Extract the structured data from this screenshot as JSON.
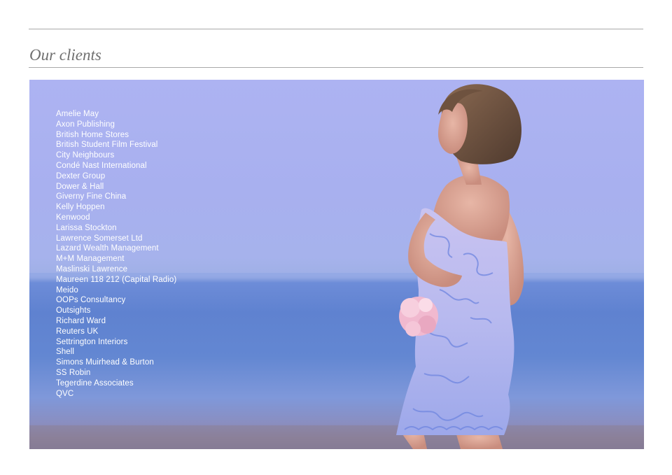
{
  "heading": "Our clients",
  "photo_icon": "model-on-beach-photo",
  "clients": [
    "Amelie May",
    "Axon Publishing",
    "British Home Stores",
    "British Student Film Festival",
    "City Neighbours",
    "Condé Nast International",
    "Dexter Group",
    "Dower & Hall",
    "Giverny Fine China",
    "Kelly Hoppen",
    "Kenwood",
    "Larissa Stockton",
    "Lawrence Somerset Ltd",
    "Lazard Wealth Management",
    "M+M Management",
    "Maslinski Lawrence",
    "Maureen 118 212 (Capital Radio)",
    "Meido",
    "OOPs Consultancy",
    "Outsights",
    "Richard Ward",
    "Reuters UK",
    "Settrington Interiors",
    "Shell",
    "Simons Muirhead & Burton",
    "SS Robin",
    "Tegerdine Associates",
    "QVC"
  ]
}
